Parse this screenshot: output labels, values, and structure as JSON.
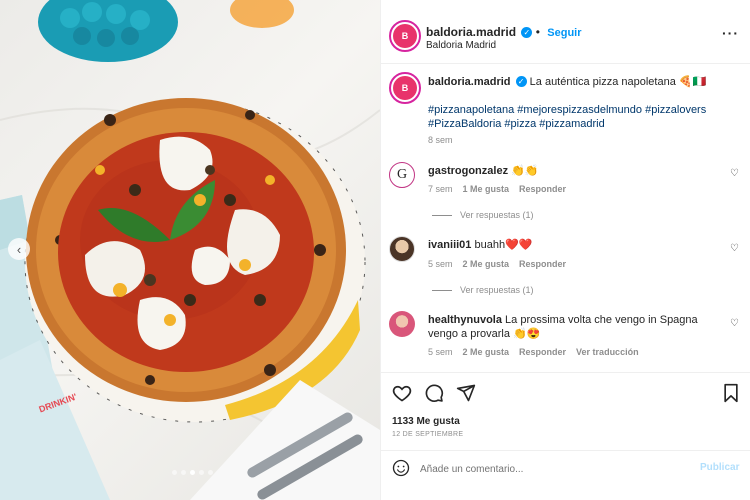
{
  "header": {
    "username": "baldoria.madrid",
    "follow_label": "Seguir",
    "location": "Baldoria Madrid",
    "more_label": "···",
    "separator": "•"
  },
  "post": {
    "caption_user": "baldoria.madrid",
    "caption_text": "La auténtica pizza napoletana 🍕🇮🇹",
    "hashtags": "#pizzanapoletana #mejorespizzasdelmundo #pizzalovers #PizzaBaldoria #pizza #pizzamadrid",
    "time": "8 sem"
  },
  "comments": [
    {
      "user": "gastrogonzalez",
      "text": "👏👏",
      "time": "7 sem",
      "likes": "1 Me gusta",
      "reply": "Responder",
      "view_replies": "Ver respuestas (1)"
    },
    {
      "user": "ivaniii01",
      "text": "buahh❤️❤️",
      "time": "5 sem",
      "likes": "2 Me gusta",
      "reply": "Responder",
      "view_replies": "Ver respuestas (1)"
    },
    {
      "user": "healthynuvola",
      "text": "La prossima volta che vengo in Spagna vengo a provarla 👏😍",
      "time": "5 sem",
      "likes": "2 Me gusta",
      "reply": "Responder",
      "translate": "Ver traducción"
    }
  ],
  "footer": {
    "likes": "1133 Me gusta",
    "date": "12 DE SEPTIEMBRE",
    "comment_placeholder": "Añade un comentario...",
    "publish_label": "Publicar"
  },
  "photo": {
    "napkin_text": "DRINKIN'",
    "carousel_prev": "‹",
    "carousel_dots": 5,
    "carousel_active_index": 2
  },
  "icons": {
    "avatar_glyph": "B",
    "verified_glyph": "✓",
    "gastro_avatar_glyph": "G",
    "comment_heart": "♡"
  },
  "colors": {
    "link": "#0095f6",
    "hashtag": "#00376b",
    "muted": "#8e8e8e",
    "brand_pink": "#e8336b"
  }
}
